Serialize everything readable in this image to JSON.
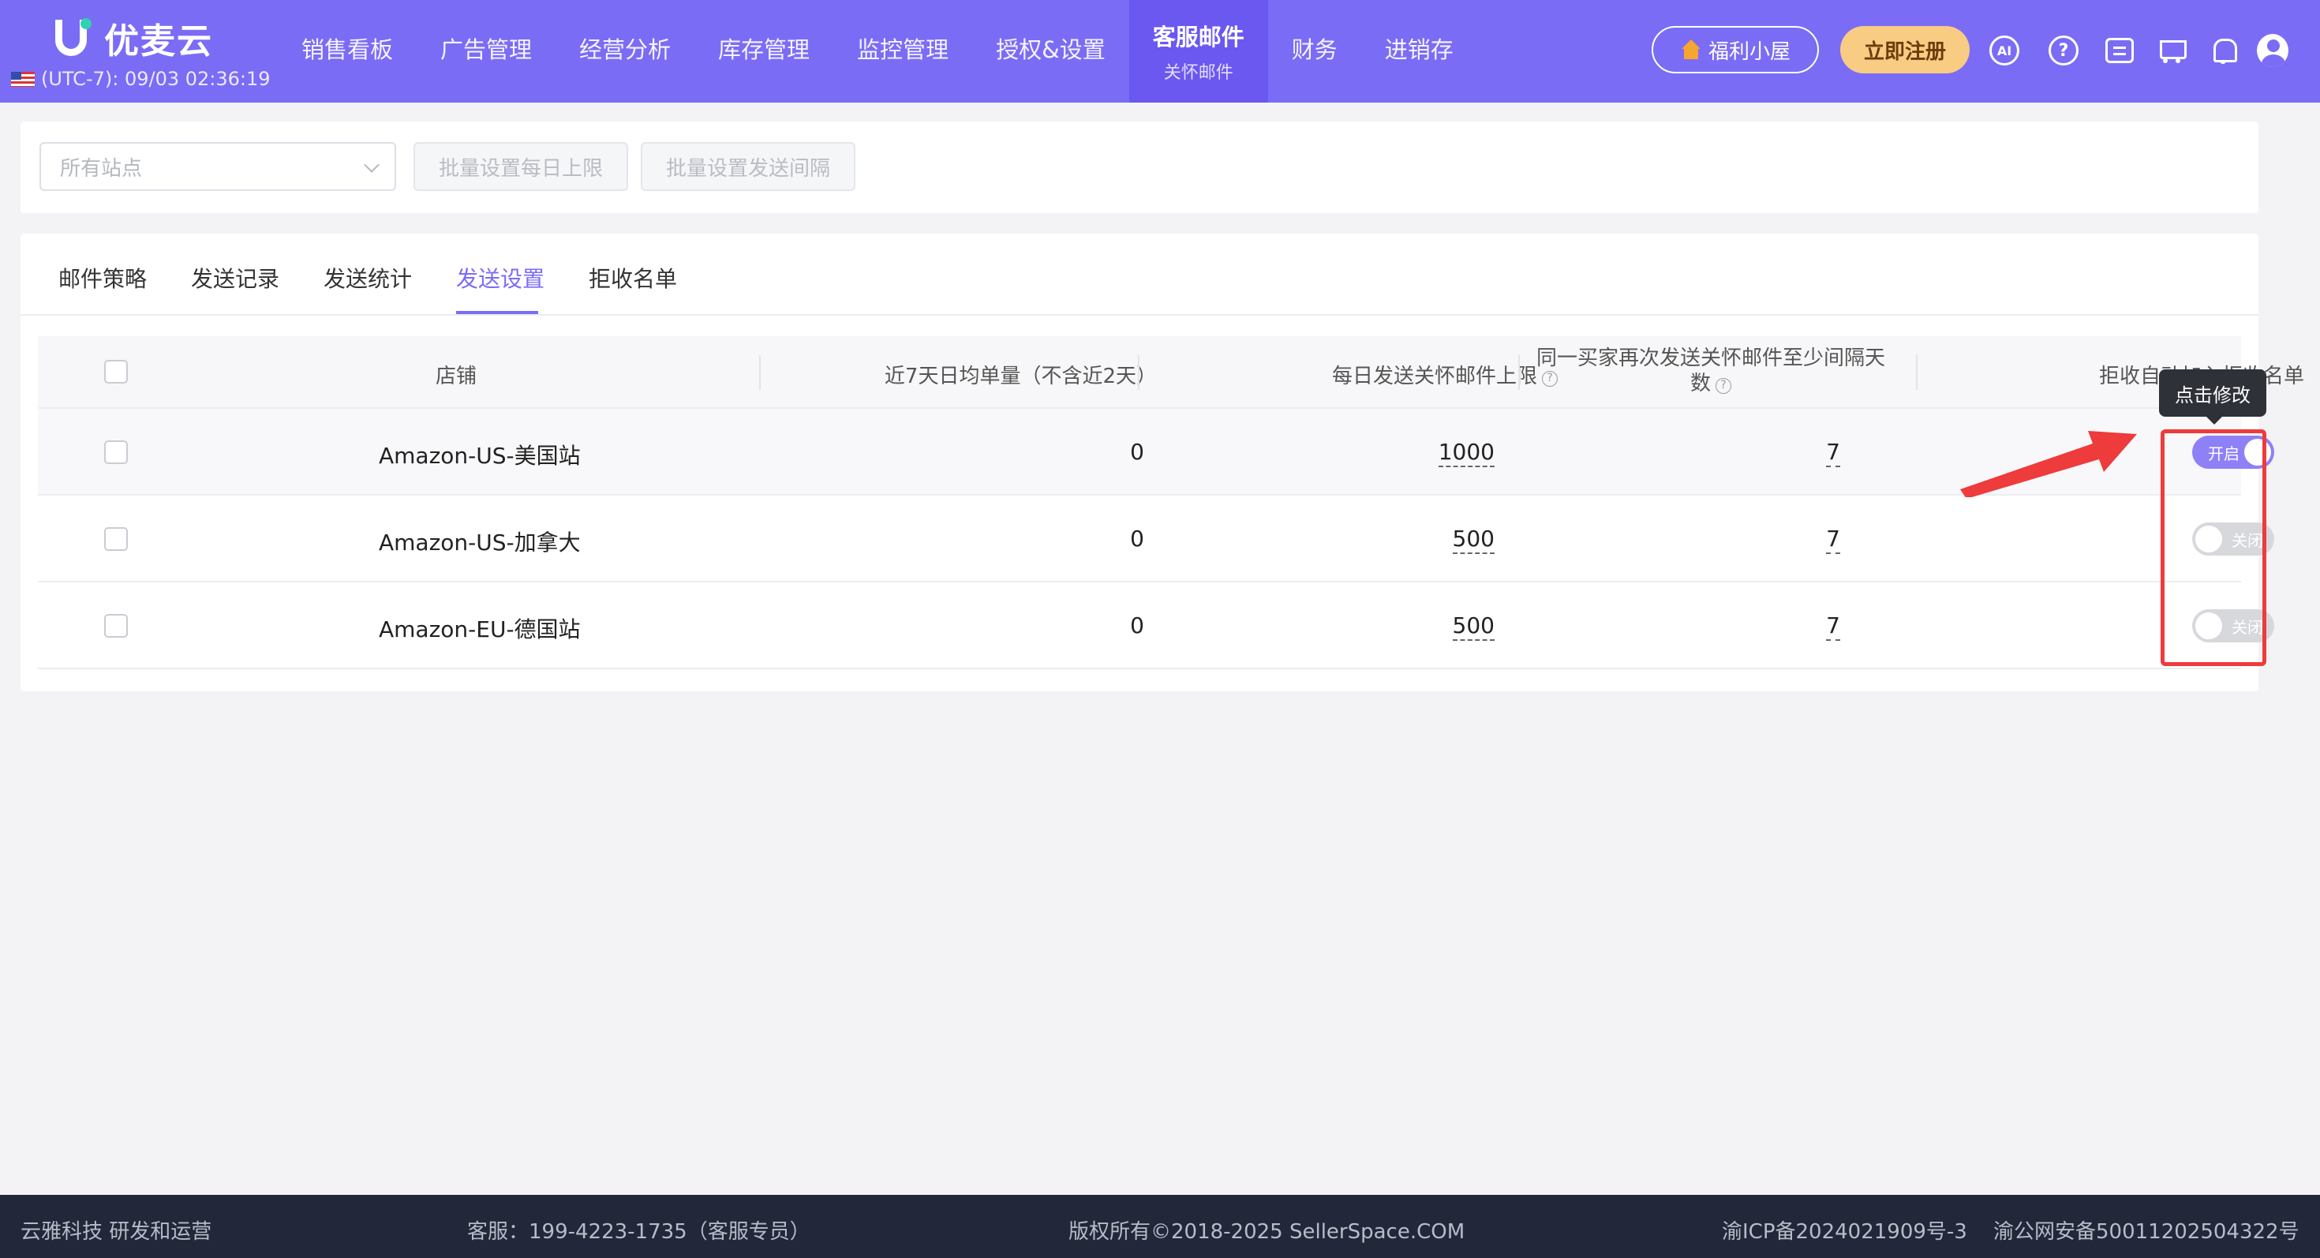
{
  "header": {
    "brand": "优麦云",
    "timezone": "(UTC-7): 09/03 02:36:19",
    "nav": [
      {
        "label": "销售看板"
      },
      {
        "label": "广告管理"
      },
      {
        "label": "经营分析"
      },
      {
        "label": "库存管理"
      },
      {
        "label": "监控管理"
      },
      {
        "label": "授权&设置"
      },
      {
        "label": "客服邮件",
        "sub": "关怀邮件",
        "active": true
      },
      {
        "label": "财务"
      },
      {
        "label": "进销存"
      }
    ],
    "welfare_label": "福利小屋",
    "register_label": "立即注册",
    "ai_label": "AI",
    "help_label": "?"
  },
  "filter": {
    "site_placeholder": "所有站点",
    "batch_daily_limit": "批量设置每日上限",
    "batch_interval": "批量设置发送间隔"
  },
  "tabs": [
    {
      "label": "邮件策略"
    },
    {
      "label": "发送记录"
    },
    {
      "label": "发送统计"
    },
    {
      "label": "发送设置",
      "active": true
    },
    {
      "label": "拒收名单"
    }
  ],
  "table": {
    "headers": {
      "store": "店铺",
      "avg_orders": "近7天日均单量（不含近2天）",
      "daily_limit": "每日发送关怀邮件上限",
      "interval_line1": "同一买家再次发送关怀邮件至少间隔天",
      "interval_line2": "数",
      "auto_reject": "拒收自动加入拒收名单"
    },
    "rows": [
      {
        "store": "Amazon-US-美国站",
        "avg_orders": "0",
        "daily_limit": "1000",
        "interval": "7",
        "auto_reject": "开启",
        "on": true
      },
      {
        "store": "Amazon-US-加拿大",
        "avg_orders": "0",
        "daily_limit": "500",
        "interval": "7",
        "auto_reject": "关闭",
        "on": false
      },
      {
        "store": "Amazon-EU-德国站",
        "avg_orders": "0",
        "daily_limit": "500",
        "interval": "7",
        "auto_reject": "关闭",
        "on": false
      }
    ]
  },
  "tooltip": "点击修改",
  "footer": {
    "company": "云雅科技 研发和运营",
    "service": "客服：199-4223-1735（客服专员）",
    "copyright": "版权所有©2018-2025 SellerSpace.COM",
    "icp": "渝ICP备2024021909号-3",
    "police": "渝公网安备50011202504322号"
  },
  "colors": {
    "brand": "#7b6cf6",
    "switch_on": "#8e80f7",
    "annotation": "#ee3b3b"
  }
}
